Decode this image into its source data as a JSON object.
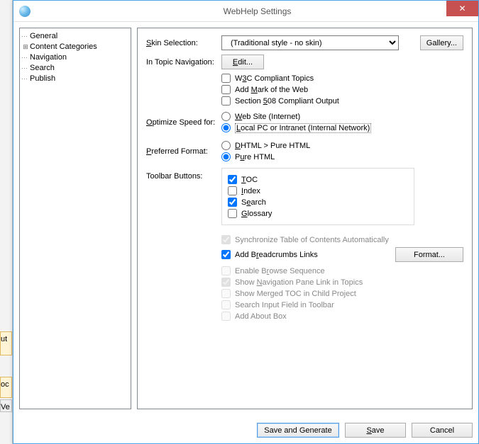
{
  "window": {
    "title": "WebHelp Settings"
  },
  "tree": {
    "items": [
      {
        "label": "General",
        "expandable": false,
        "selected": true
      },
      {
        "label": "Content Categories",
        "expandable": true
      },
      {
        "label": "Navigation",
        "expandable": false
      },
      {
        "label": "Search",
        "expandable": false
      },
      {
        "label": "Publish",
        "expandable": false
      }
    ]
  },
  "form": {
    "skin_label": "Skin Selection:",
    "skin_value": "(Traditional style - no skin)",
    "gallery_btn": "Gallery...",
    "in_topic_nav_label": "In Topic Navigation:",
    "edit_btn": "Edit...",
    "w3c": "W3C Compliant Topics",
    "add_mark": "Add Mark of the Web",
    "section508": "Section 508 Compliant Output",
    "optimize_label": "Optimize Speed for:",
    "opt_web": "Web Site (Internet)",
    "opt_local": "Local PC or Intranet (Internal Network)",
    "pref_fmt_label": "Preferred Format:",
    "fmt_dhtml": "DHTML > Pure HTML",
    "fmt_pure": "Pure HTML",
    "toolbar_label": "Toolbar Buttons:",
    "tb_toc": "TOC",
    "tb_index": "Index",
    "tb_search": "Search",
    "tb_glossary": "Glossary",
    "sync_toc": "Synchronize Table of Contents Automatically",
    "breadcrumbs": "Add Breadcrumbs Links",
    "format_btn": "Format...",
    "enable_browse": "Enable Browse Sequence",
    "show_nav_link": "Show Navigation Pane Link in Topics",
    "show_merged_toc": "Show Merged TOC in Child Project",
    "search_input_toolbar": "Search Input Field in Toolbar",
    "add_about": "Add About Box"
  },
  "footer": {
    "save_generate": "Save and Generate",
    "save": "Save",
    "cancel": "Cancel"
  }
}
